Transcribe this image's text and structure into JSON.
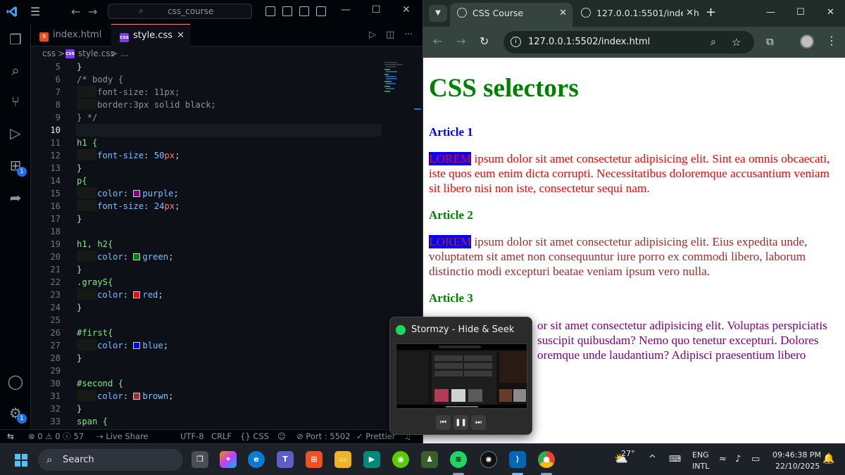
{
  "vscode": {
    "search_placeholder": "css_course",
    "tabs": [
      {
        "label": "index.html",
        "icon": "html5-icon"
      },
      {
        "label": "style.css",
        "icon": "css-icon"
      }
    ],
    "breadcrumb": {
      "folder": "css",
      "sep": ">",
      "file": "style.css",
      "more": "> ..."
    },
    "current_line": 10,
    "lines": [
      {
        "n": "5",
        "text": "}"
      },
      {
        "n": "6",
        "text": "}"
      },
      {
        "n": "7",
        "text": "/* body {"
      },
      {
        "n": "8",
        "text": "font-size: 11px;"
      },
      {
        "n": "9",
        "text": "border:3px solid black;"
      },
      {
        "n": "10",
        "text": "} */"
      },
      {
        "n": "11",
        "text": ""
      },
      {
        "n": "12",
        "text": "h1 {"
      },
      {
        "n": "13",
        "text": "font-size: 50px;"
      },
      {
        "n": "14",
        "text": "}"
      },
      {
        "n": "15",
        "text": "p{"
      },
      {
        "n": "16",
        "text": "color: purple;"
      },
      {
        "n": "17",
        "text": "font-size: 24px;"
      },
      {
        "n": "18",
        "text": "}"
      },
      {
        "n": "19",
        "text": ""
      },
      {
        "n": "20",
        "text": "h1, h2{"
      },
      {
        "n": "21",
        "text": "color: green;"
      },
      {
        "n": "22",
        "text": "}"
      },
      {
        "n": "23",
        "text": ".grayS{"
      },
      {
        "n": "24",
        "text": "color: red;"
      },
      {
        "n": "25",
        "text": "}"
      },
      {
        "n": "26",
        "text": ""
      },
      {
        "n": "27",
        "text": "#first{"
      },
      {
        "n": "28",
        "text": "color: blue;"
      },
      {
        "n": "29",
        "text": "}"
      },
      {
        "n": "30",
        "text": ""
      },
      {
        "n": "31",
        "text": "#second {"
      },
      {
        "n": "32",
        "text": "color: brown;"
      },
      {
        "n": "33",
        "text": "}"
      },
      {
        "n": "34",
        "text": "span {"
      }
    ],
    "code": {
      "l5": "}",
      "l6_a": "/* body {",
      "l7_a": "font-size: 11px;",
      "l8_a": "border:3px solid black;",
      "l9_a": "} */",
      "l11_sel": "h1 {",
      "l12_prop": "font-size",
      "l12_num": "50",
      "l12_unit": "px",
      "l13": "}",
      "l14_sel": "p{",
      "l15_prop": "color",
      "l15_val": "purple",
      "l16_prop": "font-size",
      "l16_num": "24",
      "l16_unit": "px",
      "l17": "}",
      "l19_sel": "h1, h2{",
      "l20_prop": "color",
      "l20_val": "green",
      "l21": "}",
      "l22_sel": ".grayS{",
      "l23_prop": "color",
      "l23_val": "red",
      "l24": "}",
      "l26_sel": "#first{",
      "l27_prop": "color",
      "l27_val": "blue",
      "l28": "}",
      "l30_sel": "#second {",
      "l31_prop": "color",
      "l31_val": "brown",
      "l32": "}",
      "l33_sel": "span {"
    },
    "line_numbers": [
      "5",
      "6",
      "7",
      "8",
      "9",
      "10",
      "11",
      "12",
      "13",
      "14",
      "15",
      "16",
      "17",
      "18",
      "19",
      "20",
      "21",
      "22",
      "23",
      "24",
      "25",
      "26",
      "27",
      "28",
      "29",
      "30",
      "31",
      "32",
      "33"
    ],
    "status": {
      "errors": "0",
      "warnings": "0",
      "info": "57",
      "live_share": "Live Share",
      "encoding": "UTF-8",
      "eol": "CRLF",
      "language": "CSS",
      "port": "Port : 5502",
      "prettier": "Prettier"
    },
    "badges": {
      "extensions": "1",
      "settings": "1"
    },
    "swatches": {
      "purple": "#800080",
      "green": "#008000",
      "red": "#ff0000",
      "blue": "#0000ff",
      "brown": "#a52a2a"
    }
  },
  "browser": {
    "tabs": [
      {
        "label": "CSS Course"
      },
      {
        "label": "127.0.0.1:5501/index.h"
      }
    ],
    "url": "127.0.0.1:5502/index.html",
    "page": {
      "title": "CSS selectors",
      "articles": [
        {
          "heading": "Article 1",
          "lorem": "LOREM",
          "body": " ipsum dolor sit amet consectetur adipisicing elit. Sint ea omnis obcaecati, iste quos eum enim dicta corrupti. Necessitatibus doloremque accusantium veniam sit libero nisi non iste, consectetur sequi nam.",
          "heading_color": "#0000ff",
          "text_color": "#ff0000"
        },
        {
          "heading": "Article 2",
          "lorem": "LOREM",
          "body": " ipsum dolor sit amet consectetur adipisicing elit. Eius expedita unde, voluptatem sit amet non consequuntur iure porro ex commodi libero, laborum distinctio modi excepturi beatae veniam ipsum vero nulla.",
          "heading_color": "#008000",
          "text_color": "#a52a2a"
        },
        {
          "heading": "Article 3",
          "body_visible": "or sit amet consectetur adipisicing elit. Voluptas perspiciatis suscipit quibusdam? Nemo quo tenetur excepturi. Dolores oremque unde laudantium? Adipisci praesentium libero",
          "heading_color": "#008000",
          "text_color": "#800080"
        }
      ]
    }
  },
  "spotify_popup": {
    "title": "Stormzy - Hide & Seek",
    "controls": [
      "previous-icon",
      "pause-icon",
      "next-icon"
    ]
  },
  "taskbar": {
    "search_label": "Search",
    "weather": "27°",
    "language_line1": "ENG",
    "language_line2": "INTL",
    "time": "09:46:38 PM",
    "date": "22/10/2025"
  }
}
